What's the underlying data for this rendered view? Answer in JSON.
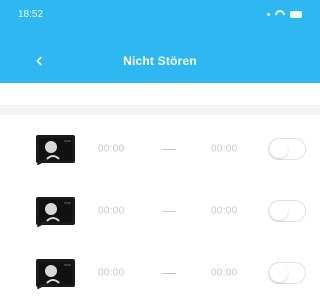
{
  "status_bar": {
    "time": "18:52",
    "icons": [
      "signal-dot-icon",
      "wifi-icon",
      "battery-icon"
    ]
  },
  "header": {
    "title": "Nicht Stören",
    "back_icon": "back-chevron-icon",
    "background_color": "#2eb7f0"
  },
  "schedules": [
    {
      "start": "00:00",
      "end": "00:00",
      "enabled": false
    },
    {
      "start": "00:00",
      "end": "00:00",
      "enabled": false
    },
    {
      "start": "00:00",
      "end": "00:00",
      "enabled": false
    }
  ]
}
